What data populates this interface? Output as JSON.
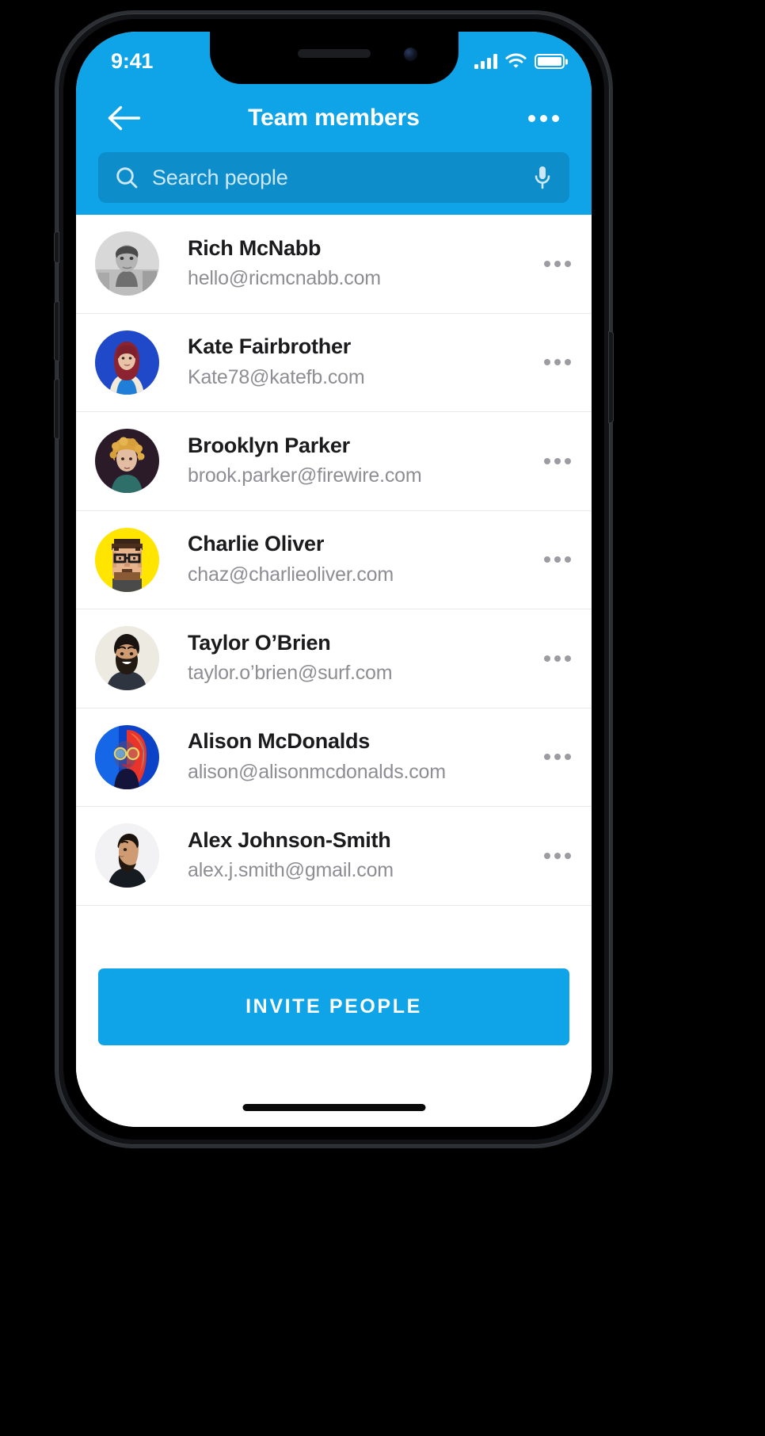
{
  "status_bar": {
    "time": "9:41",
    "signal_icon": "cellular-signal-icon",
    "wifi_icon": "wifi-icon",
    "battery_icon": "battery-full-icon"
  },
  "header": {
    "back_icon": "arrow-left-icon",
    "title": "Team members",
    "overflow_icon": "more-horizontal-icon",
    "accent_color": "#0FA3E8"
  },
  "search": {
    "icon": "search-icon",
    "placeholder": "Search people",
    "value": "",
    "mic_icon": "microphone-icon"
  },
  "list": {
    "row_more_icon": "more-horizontal-icon",
    "members": [
      {
        "name": "Rich McNabb",
        "email": "hello@ricmcnabb.com",
        "avatar": "avatar-rich-mcnabb"
      },
      {
        "name": "Kate Fairbrother",
        "email": "Kate78@katefb.com",
        "avatar": "avatar-kate-fairbrother"
      },
      {
        "name": "Brooklyn Parker",
        "email": "brook.parker@firewire.com",
        "avatar": "avatar-brooklyn-parker"
      },
      {
        "name": "Charlie Oliver",
        "email": "chaz@charlieoliver.com",
        "avatar": "avatar-charlie-oliver"
      },
      {
        "name": "Taylor O’Brien",
        "email": "taylor.o’brien@surf.com",
        "avatar": "avatar-taylor-obrien"
      },
      {
        "name": "Alison McDonalds",
        "email": "alison@alisonmcdonalds.com",
        "avatar": "avatar-alison-mcdonalds"
      },
      {
        "name": "Alex Johnson-Smith",
        "email": "alex.j.smith@gmail.com",
        "avatar": "avatar-alex-johnson-smith"
      }
    ]
  },
  "footer": {
    "cta_label": "INVITE PEOPLE",
    "cta_color": "#0FA3E8"
  }
}
